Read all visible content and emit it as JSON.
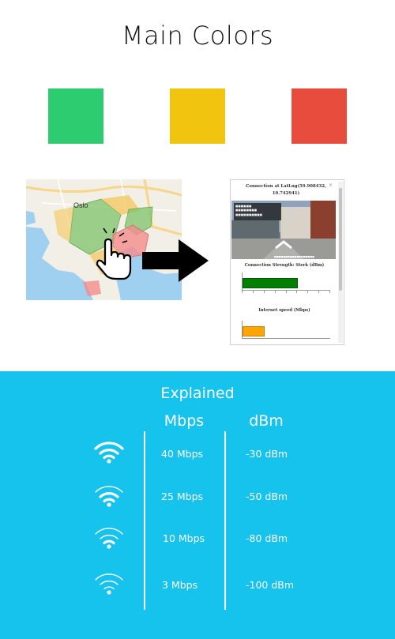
{
  "title": "Main Colors",
  "colors": [
    {
      "name": "green",
      "hex": "#2ecc71"
    },
    {
      "name": "yellow",
      "hex": "#f1c40f"
    },
    {
      "name": "red",
      "hex": "#e74c3c"
    }
  ],
  "map": {
    "label": "Oslo",
    "icons": [
      "hand-pointer-icon",
      "arrow-right-icon"
    ]
  },
  "popup": {
    "title": "Connection at LatLng(59.908432, 10.742941)",
    "close": "×",
    "connection_label": "Connection Strength: Sterk (dBm)",
    "connection_color": "#008000",
    "connection_fraction": 0.62,
    "internet_label": "Internet speed (Mbps)",
    "internet_color": "#ffa500",
    "internet_fraction": 0.24
  },
  "explained": {
    "heading": "Explained",
    "columns": {
      "mbps": "Mbps",
      "dbm": "dBm"
    },
    "rows": [
      {
        "icon": "wifi-strength-4-icon",
        "mbps": "40 Mbps",
        "dbm": "-30 dBm"
      },
      {
        "icon": "wifi-strength-3-icon",
        "mbps": "25 Mbps",
        "dbm": "-50 dBm"
      },
      {
        "icon": "wifi-strength-2-icon",
        "mbps": "10 Mbps",
        "dbm": "-80 dBm"
      },
      {
        "icon": "wifi-strength-1-icon",
        "mbps": "3 Mbps",
        "dbm": "-100 dBm"
      }
    ],
    "panel_color": "#15c3ec"
  }
}
